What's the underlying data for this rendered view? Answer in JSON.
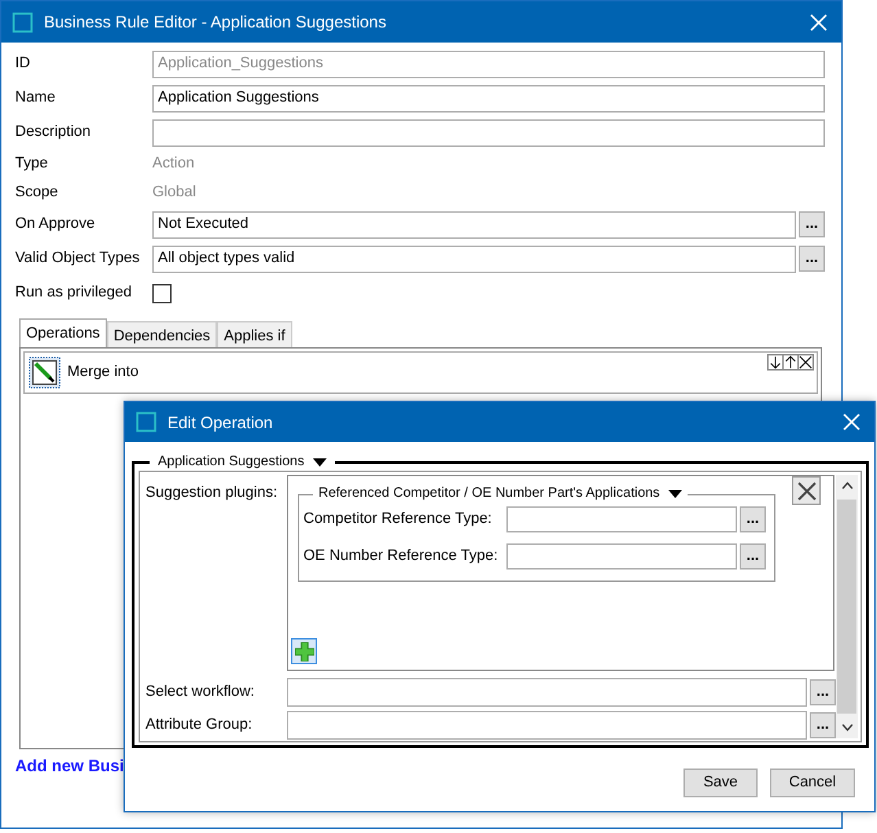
{
  "main_window": {
    "title": "Business Rule Editor - Application Suggestions",
    "fields": [
      {
        "label": "ID",
        "kind": "readonly",
        "value": "Application_Suggestions"
      },
      {
        "label": "Name",
        "kind": "field",
        "value": "Application Suggestions"
      },
      {
        "label": "Description",
        "kind": "field"
      },
      {
        "label": "Type",
        "kind": "text",
        "value": "Action"
      },
      {
        "label": "Scope",
        "kind": "text",
        "value": "Global"
      },
      {
        "label": "On Approve",
        "kind": "browse",
        "value": "Not Executed",
        "button": "..."
      },
      {
        "label": "Valid Object Types",
        "kind": "browse",
        "value": "All object types valid",
        "button": "..."
      },
      {
        "label": "Run as privileged",
        "kind": "checkbox",
        "checked": false
      }
    ],
    "tabs": [
      {
        "label": "Operations",
        "selected": true
      },
      {
        "label": "Dependencies",
        "selected": false
      },
      {
        "label": "Applies if",
        "selected": false
      }
    ],
    "operations": [
      {
        "label": "Merge  into"
      }
    ],
    "link": "Add new Busi"
  },
  "dialog": {
    "title": "Edit Operation",
    "group_title": "Application Suggestions",
    "plugins_label": "Suggestion plugins:",
    "plugin": {
      "title": "Referenced Competitor / OE Number Part's Applications",
      "fields": [
        {
          "label": "Competitor Reference Type:",
          "button": "..."
        },
        {
          "label": "OE Number Reference Type:",
          "button": "..."
        }
      ]
    },
    "fields": [
      {
        "label": "Select workflow:",
        "button": "..."
      },
      {
        "label": "Attribute Group:",
        "button": "..."
      }
    ],
    "buttons": [
      "Save",
      "Cancel"
    ]
  }
}
